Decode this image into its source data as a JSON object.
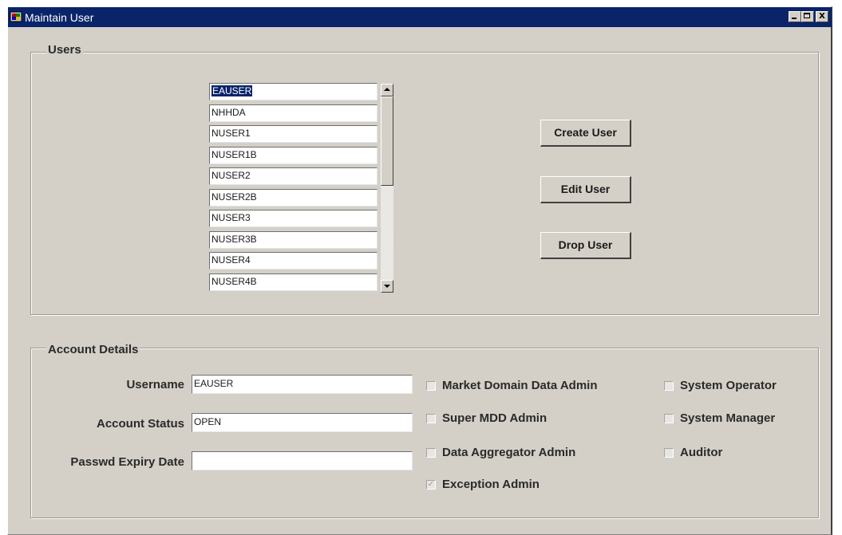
{
  "window": {
    "title": "Maintain User",
    "controls": {
      "minimize": "minimize",
      "maximize": "maximize",
      "close": "X"
    }
  },
  "users_group": {
    "label": "Users",
    "list": [
      "EAUSER",
      "NHHDA",
      "NUSER1",
      "NUSER1B",
      "NUSER2",
      "NUSER2B",
      "NUSER3",
      "NUSER3B",
      "NUSER4",
      "NUSER4B"
    ],
    "selected_index": 0,
    "buttons": {
      "create": "Create User",
      "edit": "Edit User",
      "drop": "Drop User"
    }
  },
  "account_group": {
    "label": "Account Details",
    "fields": {
      "username_label": "Username",
      "username_value": "EAUSER",
      "status_label": "Account Status",
      "status_value": "OPEN",
      "expiry_label": "Passwd Expiry Date",
      "expiry_value": ""
    },
    "roles": {
      "market_domain": {
        "label": "Market Domain Data Admin",
        "checked": false
      },
      "super_mdd": {
        "label": "Super MDD Admin",
        "checked": false
      },
      "data_aggregator": {
        "label": "Data Aggregator Admin",
        "checked": false
      },
      "exception": {
        "label": "Exception Admin",
        "checked": true
      },
      "system_operator": {
        "label": "System Operator",
        "checked": false
      },
      "system_manager": {
        "label": "System Manager",
        "checked": false
      },
      "auditor": {
        "label": "Auditor",
        "checked": false
      }
    }
  },
  "colors": {
    "titlebar": "#0a246a",
    "face": "#d4d0c8",
    "selection": "#0a246a"
  }
}
